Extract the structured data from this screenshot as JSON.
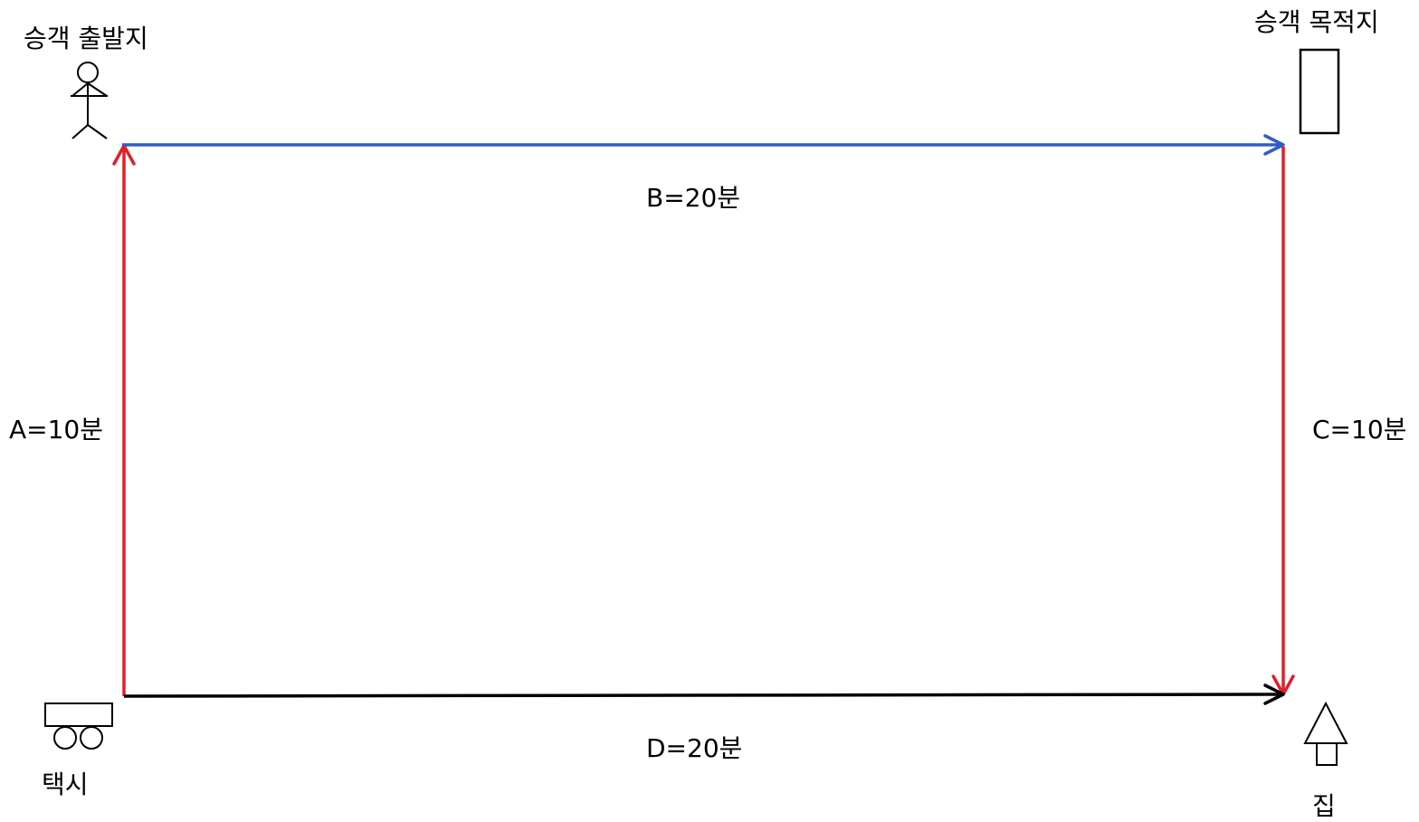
{
  "nodes": {
    "origin": {
      "label": "승객 출발지",
      "icon": "stick-figure-icon"
    },
    "destination": {
      "label": "승객 목적지",
      "icon": "building-icon"
    },
    "taxi": {
      "label": "택시",
      "icon": "taxi-icon"
    },
    "home": {
      "label": "집",
      "icon": "house-icon"
    }
  },
  "edges": {
    "a": {
      "label": "A=10분",
      "color": "#e0202a"
    },
    "b": {
      "label": "B=20분",
      "color": "#2f5fc4"
    },
    "c": {
      "label": "C=10분",
      "color": "#e0202a"
    },
    "d": {
      "label": "D=20분",
      "color": "#000000"
    }
  }
}
